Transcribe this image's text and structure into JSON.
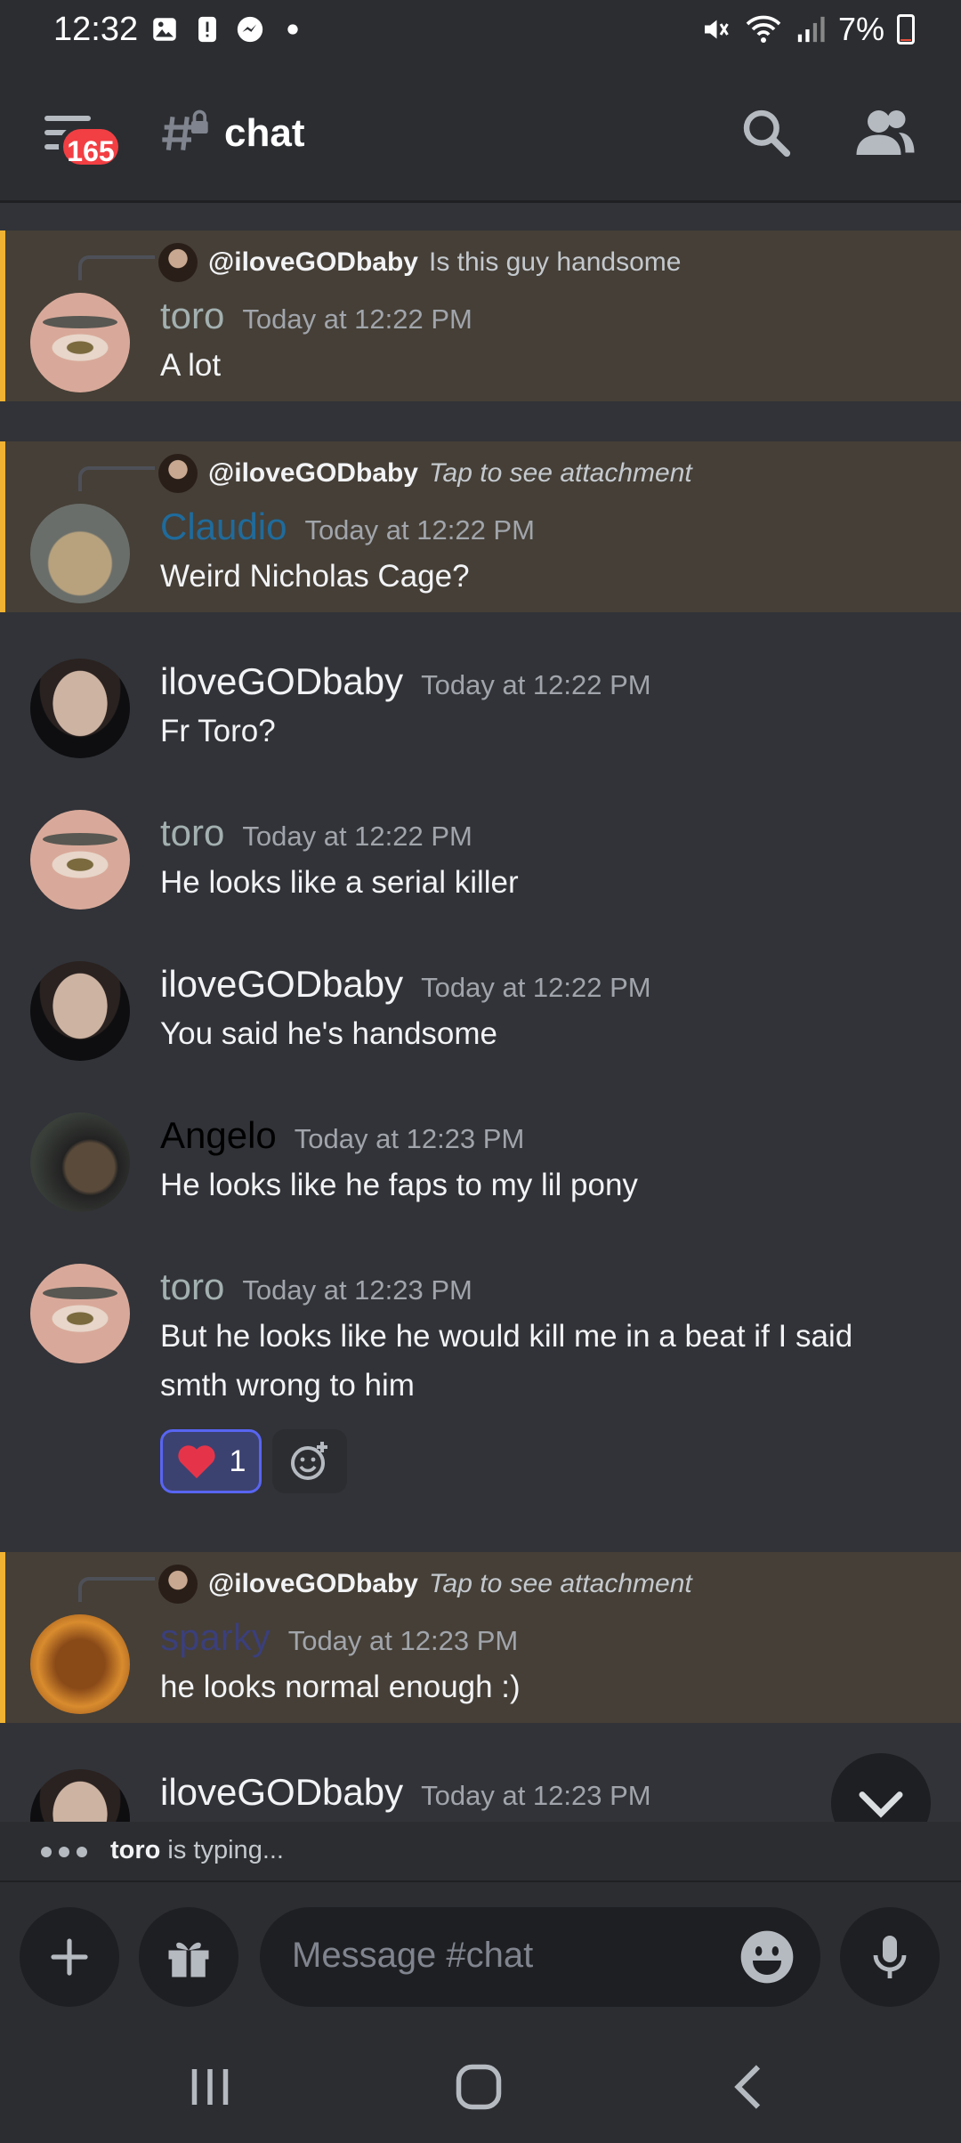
{
  "status_bar": {
    "time": "12:32",
    "battery": "7%",
    "battery_level": 0.07
  },
  "header": {
    "unread_badge": "165",
    "channel_name": "chat"
  },
  "messages": [
    {
      "reply_user": "@iloveGODbaby",
      "reply_text": "Is this guy handsome",
      "author": "toro",
      "author_color": "#a3b0b0",
      "time": "Today at 12:22 PM",
      "text": "A lot"
    },
    {
      "reply_user": "@iloveGODbaby",
      "reply_text": "Tap to see attachment",
      "author": "Claudio",
      "author_color": "#1f6b9c",
      "time": "Today at 12:22 PM",
      "text": "Weird Nicholas Cage?"
    },
    {
      "author": "iloveGODbaby",
      "author_color": "#f2f3f5",
      "time": "Today at 12:22 PM",
      "text": "Fr Toro?"
    },
    {
      "author": "toro",
      "author_color": "#a3b0b0",
      "time": "Today at 12:22 PM",
      "text": "He looks like a serial killer"
    },
    {
      "author": "iloveGODbaby",
      "author_color": "#f2f3f5",
      "time": "Today at 12:22 PM",
      "text": "You said he's handsome"
    },
    {
      "author": "Angelo",
      "author_color": "#000000",
      "time": "Today at 12:23 PM",
      "text": "He looks like he faps to my lil pony"
    },
    {
      "author": "toro",
      "author_color": "#a3b0b0",
      "time": "Today at 12:23 PM",
      "text": "But he looks like he would kill me in a beat if I said smth wrong to him",
      "reaction_count": "1"
    },
    {
      "reply_user": "@iloveGODbaby",
      "reply_text": "Tap to see attachment",
      "author": "sparky",
      "author_color": "#3b3f7a",
      "time": "Today at 12:23 PM",
      "text": "he looks normal enough :)"
    },
    {
      "author": "iloveGODbaby",
      "author_color": "#f2f3f5",
      "time": "Today at 12:23 PM"
    }
  ],
  "typing": {
    "user": "toro",
    "suffix": " is typing..."
  },
  "composer": {
    "placeholder": "Message #chat"
  }
}
